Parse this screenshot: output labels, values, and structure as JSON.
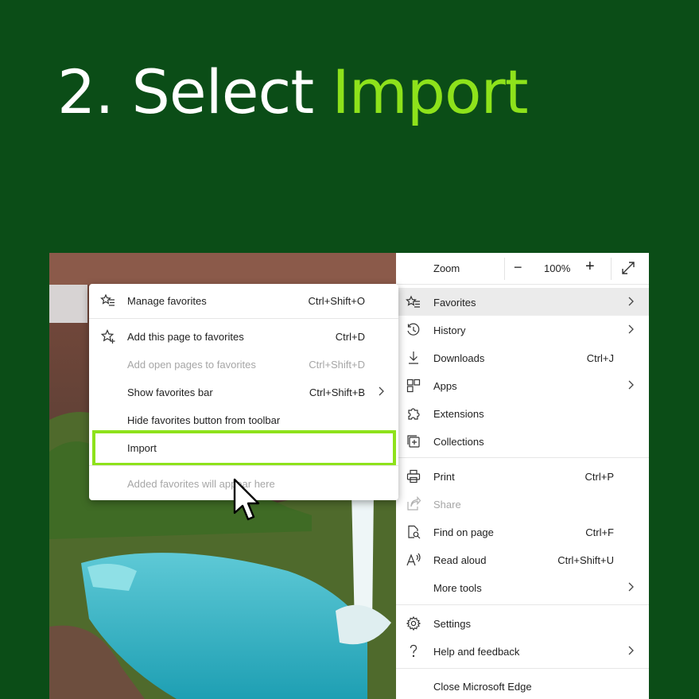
{
  "headline": {
    "prefix": "2. Select",
    "accent": "Import"
  },
  "colors": {
    "background": "#0b4d17",
    "accent": "#8ee21b",
    "menu_bg": "#ffffff",
    "highlight": "#ebebeb"
  },
  "settings_menu": {
    "zoom": {
      "label": "Zoom",
      "minus": "−",
      "value": "100%",
      "plus": "+",
      "fullscreen_icon": "fullscreen-icon"
    },
    "items": [
      {
        "label": "Favorites",
        "icon": "favorites-icon",
        "has_submenu": true,
        "active": true
      },
      {
        "label": "History",
        "icon": "history-icon",
        "has_submenu": true
      },
      {
        "label": "Downloads",
        "icon": "download-icon",
        "shortcut": "Ctrl+J"
      },
      {
        "label": "Apps",
        "icon": "apps-icon",
        "has_submenu": true
      },
      {
        "label": "Extensions",
        "icon": "puzzle-icon"
      },
      {
        "label": "Collections",
        "icon": "collections-icon"
      },
      {
        "label": "Print",
        "icon": "printer-icon",
        "shortcut": "Ctrl+P"
      },
      {
        "label": "Share",
        "icon": "share-icon",
        "disabled": true
      },
      {
        "label": "Find on page",
        "icon": "find-icon",
        "shortcut": "Ctrl+F"
      },
      {
        "label": "Read aloud",
        "icon": "read-aloud-icon",
        "shortcut": "Ctrl+Shift+U"
      },
      {
        "label": "More tools",
        "has_submenu": true
      },
      {
        "label": "Settings",
        "icon": "gear-icon"
      },
      {
        "label": "Help and feedback",
        "icon": "help-icon",
        "has_submenu": true
      },
      {
        "label": "Close Microsoft Edge"
      }
    ]
  },
  "favorites_submenu": {
    "items": [
      {
        "label": "Manage favorites",
        "icon": "favorites-list-icon",
        "shortcut": "Ctrl+Shift+O"
      },
      {
        "label": "Add this page to favorites",
        "icon": "star-add-icon",
        "shortcut": "Ctrl+D"
      },
      {
        "label": "Add open pages to favorites",
        "shortcut": "Ctrl+Shift+D",
        "disabled": true
      },
      {
        "label": "Show favorites bar",
        "shortcut": "Ctrl+Shift+B",
        "has_submenu": true
      },
      {
        "label": "Hide favorites button from toolbar"
      },
      {
        "label": "Import",
        "highlighted": true
      },
      {
        "label": "Added favorites will appear here",
        "disabled": true
      }
    ]
  }
}
